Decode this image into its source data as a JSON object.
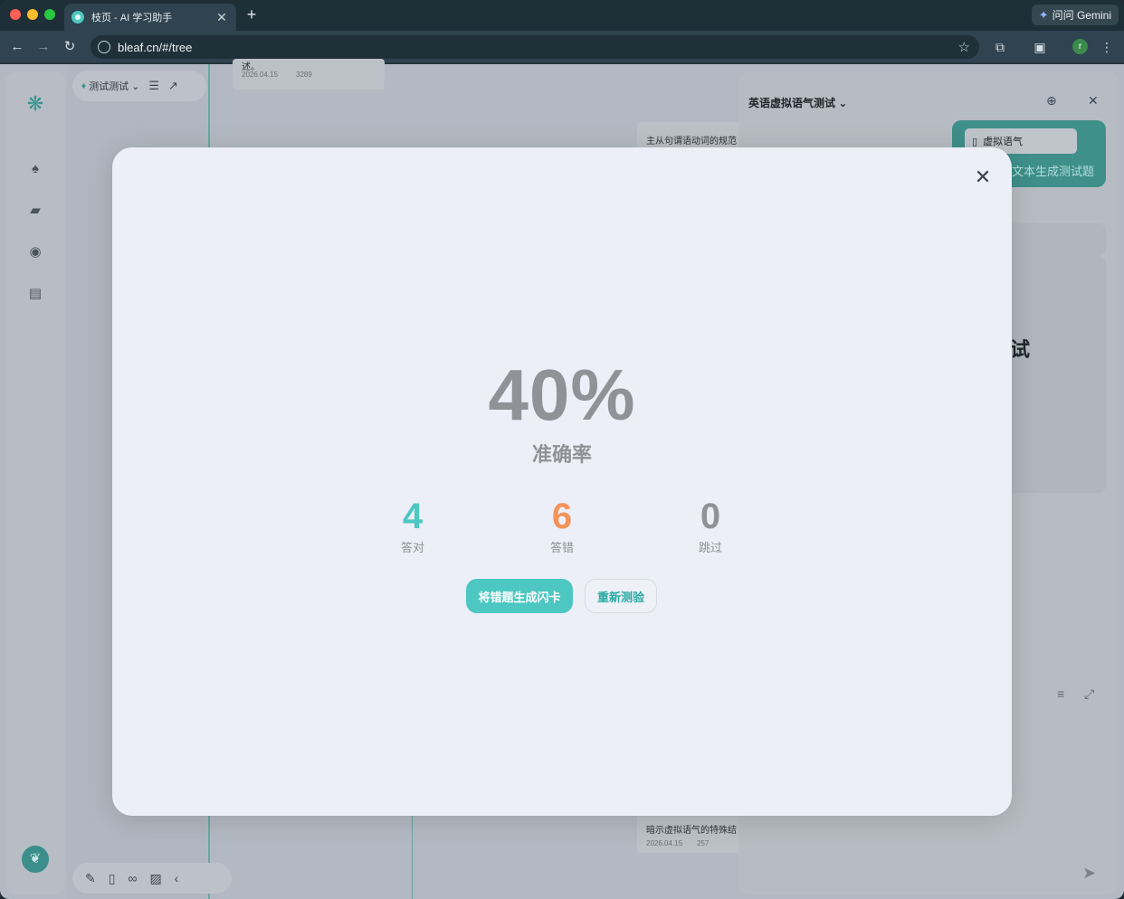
{
  "browser": {
    "tab_title": "枝页 - AI 学习助手",
    "new_tab_icon": "+",
    "gemini_label": "问问 Gemini",
    "url": "bleaf.cn/#/tree",
    "profile_initial": "r"
  },
  "sidebar": {
    "logo_icon": "leaf-logo-icon",
    "items": [
      {
        "icon": "tree-icon"
      },
      {
        "icon": "cards-icon"
      },
      {
        "icon": "ai-icon"
      },
      {
        "icon": "archive-icon"
      }
    ]
  },
  "tree": {
    "name": "测试测试",
    "cards": [
      {
        "text": "述。",
        "date": "2026.04.15",
        "count": "3289"
      },
      {
        "text": "主从句谓语动词的规范"
      },
      {
        "text": "暗示虚拟语气的特殊结",
        "date": "2026.04.15",
        "count": "257"
      }
    ]
  },
  "panel": {
    "title": "英语虚拟语气测试",
    "chip_label": "虚拟语气",
    "generate_label": "文本生成测试题",
    "big_text": "试"
  },
  "quiz_result": {
    "percent": "40%",
    "percent_label": "准确率",
    "correct": {
      "value": "4",
      "label": "答对",
      "color": "#4dc7c1"
    },
    "wrong": {
      "value": "6",
      "label": "答错",
      "color": "#f4935a"
    },
    "skipped": {
      "value": "0",
      "label": "跳过",
      "color": "#8f9297"
    },
    "make_flashcards_label": "将错题生成闪卡",
    "retry_label": "重新测验"
  }
}
